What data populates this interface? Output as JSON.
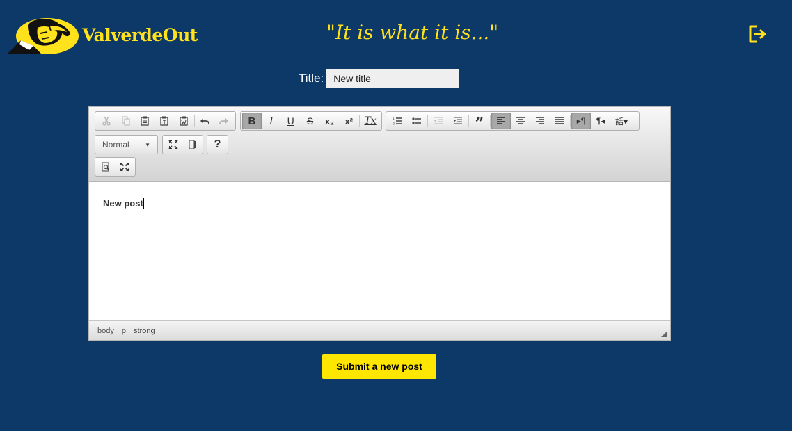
{
  "brand": {
    "name": "ValverdeOut",
    "logo_icon": "facepalm-man-logo",
    "accent_color": "#ffe11c"
  },
  "header": {
    "tagline": "\"It is what it is...\"",
    "logout_icon": "logout-icon"
  },
  "form": {
    "title_label": "Title:",
    "title_value": "New title",
    "submit_label": "Submit a new post"
  },
  "editor": {
    "toolbar_row1": {
      "clipboard": [
        "cut",
        "copy",
        "paste",
        "paste-text",
        "paste-word"
      ],
      "history": [
        "undo",
        "redo"
      ],
      "basicstyles": [
        "B",
        "I",
        "U",
        "S",
        "x₂",
        "x²",
        "Tx"
      ],
      "paragraph": [
        "numbered-list",
        "bulleted-list",
        "outdent",
        "indent",
        "blockquote",
        "align-left",
        "align-center",
        "align-right",
        "justify",
        "ltr",
        "rtl",
        "language"
      ]
    },
    "format_combo": "Normal",
    "help_label": "?",
    "body_text": "New post",
    "elements_path": [
      "body",
      "p",
      "strong"
    ]
  },
  "colors": {
    "background": "#0c3968",
    "submit": "#ffe600"
  }
}
